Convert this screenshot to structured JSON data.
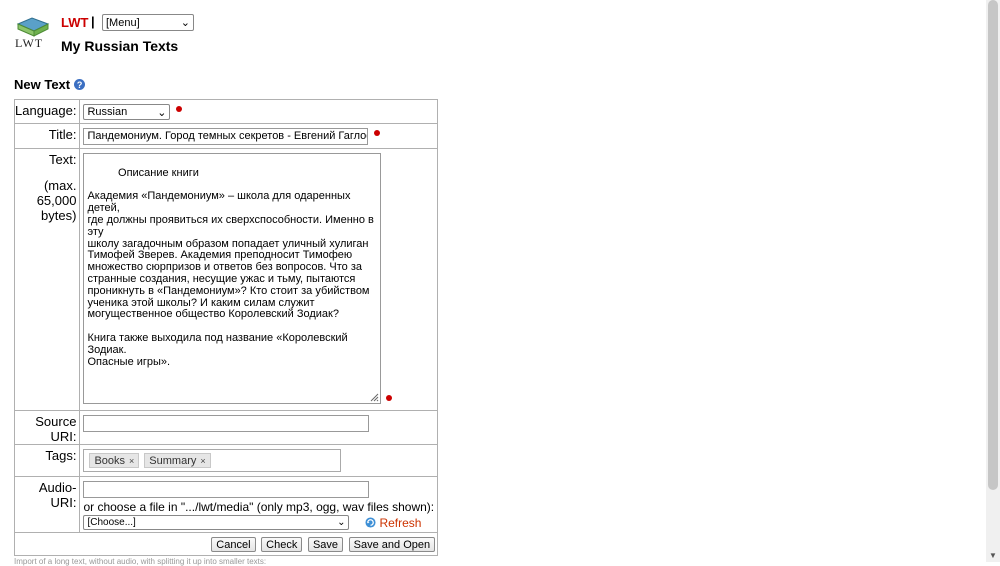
{
  "header": {
    "brand": "LWT",
    "separator": "|",
    "logo_text": "LWT",
    "menu_value": "[Menu]",
    "page_title": "My Russian Texts"
  },
  "section": {
    "title": "New Text",
    "help_icon": "?"
  },
  "form": {
    "language": {
      "label": "Language:",
      "value": "Russian"
    },
    "title": {
      "label": "Title:",
      "value": "Пандемониум. Город темных секретов - Евгений Гаглоев"
    },
    "text": {
      "label": "Text:",
      "hint": "(max.\n65,000\nbytes)",
      "value": "Описание книги\n\nАкадемия «Пандемониум» – школа для одаренных детей,\nгде должны проявиться их сверхспособности. Именно в эту\nшколу загадочным образом попадает уличный хулиган\nТимофей Зверев. Академия преподносит Тимофею\nмножество сюрпризов и ответов без вопросов. Что за\nстранные создания, несущие ужас и тьму, пытаются\nпроникнуть в «Пандемониум»? Кто стоит за убийством\nученика этой школы? И каким силам служит\nмогущественное общество Королевский Зодиак?\n\nКнига также выходила под название «Королевский Зодиак.\nОпасные игры»."
    },
    "source_uri": {
      "label": "Source URI:",
      "value": ""
    },
    "tags": {
      "label": "Tags:",
      "items": [
        "Books",
        "Summary"
      ],
      "remove_icon": "×"
    },
    "audio_uri": {
      "label": "Audio-URI:",
      "value": "",
      "choose_text": "or choose a file in \".../lwt/media\" (only mp3, ogg, wav files shown):",
      "choose_value": "[Choose...]",
      "refresh_label": "Refresh"
    },
    "buttons": {
      "cancel": "Cancel",
      "check": "Check",
      "save": "Save",
      "save_open": "Save and Open"
    }
  },
  "footer_note": "Import of a long text, without audio, with splitting it up into smaller texts:",
  "colors": {
    "required": "#cc0000",
    "brand": "#cc0000",
    "help": "#3b6fc2"
  }
}
